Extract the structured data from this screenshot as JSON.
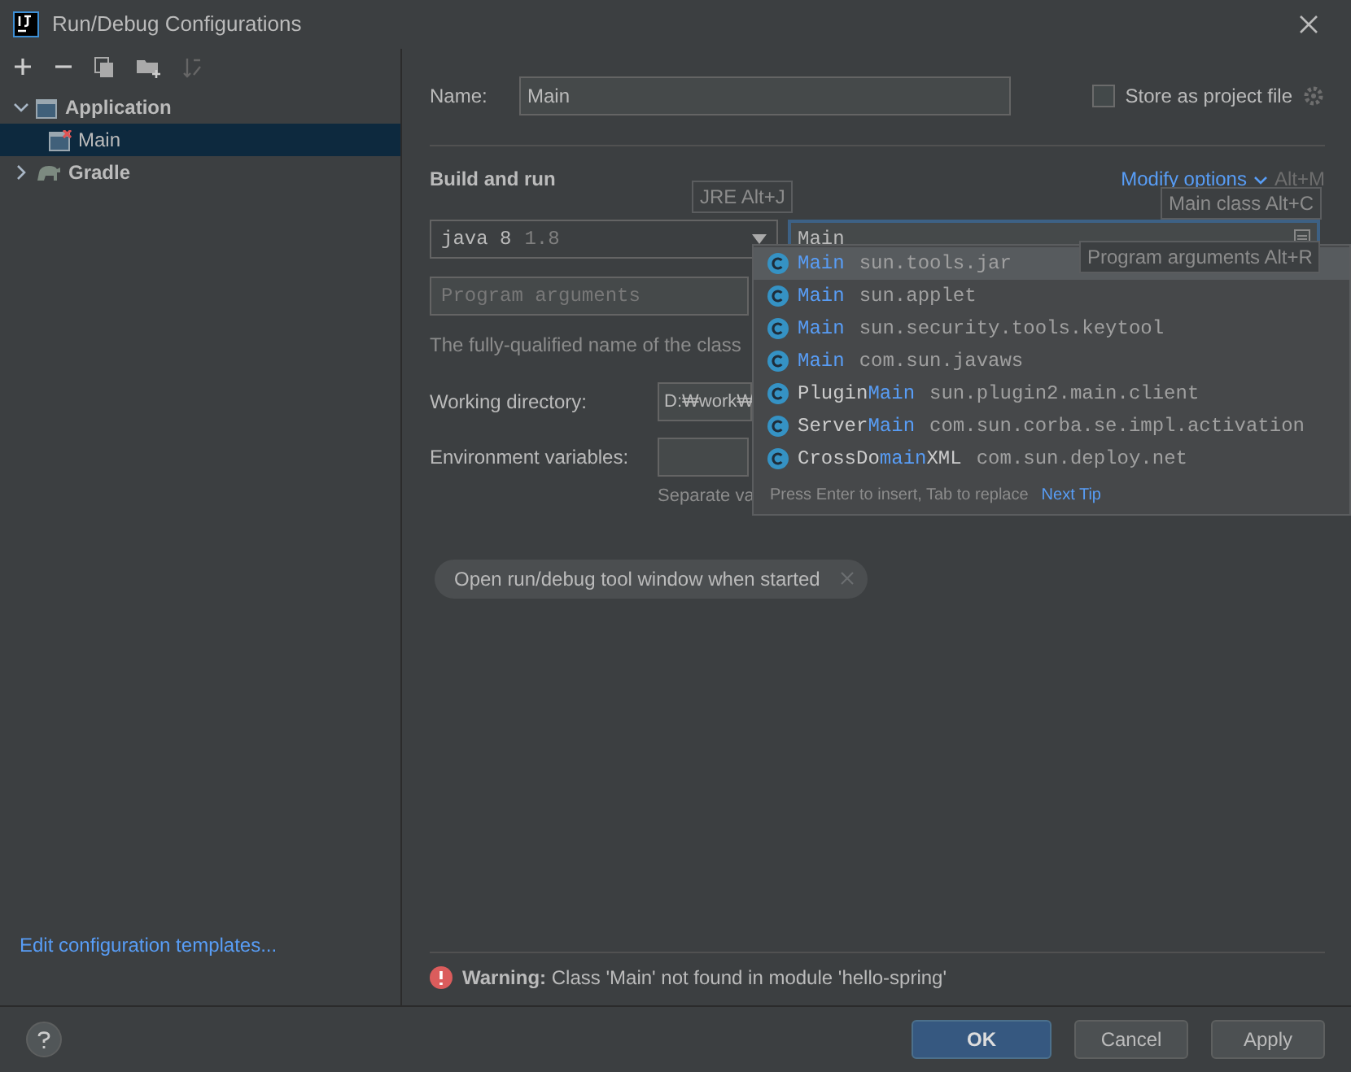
{
  "window": {
    "title": "Run/Debug Configurations"
  },
  "sidebar": {
    "tree": [
      {
        "label": "Application",
        "expanded": true,
        "selected": false,
        "children": [
          {
            "label": "Main",
            "selected": true
          }
        ]
      },
      {
        "label": "Gradle",
        "expanded": false,
        "selected": false
      }
    ],
    "footer_link": "Edit configuration templates..."
  },
  "name_field": {
    "label": "Name:",
    "value": "Main"
  },
  "store_as_project_file": {
    "label": "Store as project file",
    "checked": false
  },
  "build_and_run": {
    "title": "Build and run",
    "modify_options": "Modify options",
    "modify_shortcut": "Alt+M",
    "jre": {
      "value": "java 8",
      "version": "1.8"
    },
    "main_class": {
      "value": "Main"
    },
    "program_arguments": {
      "placeholder": "Program arguments"
    },
    "hint": "The fully-qualified name of the class"
  },
  "working_directory": {
    "label": "Working directory:",
    "value": "D:₩work₩"
  },
  "environment_variables": {
    "label": "Environment variables:",
    "hint": "Separate va"
  },
  "chips": [
    {
      "label": "Open run/debug tool window when started"
    }
  ],
  "tooltips": {
    "jre": "JRE Alt+J",
    "main_class": "Main class Alt+C",
    "program_arguments": "Program arguments Alt+R"
  },
  "completion_popup": {
    "items": [
      {
        "parts": [
          {
            "text": "Main",
            "match": true
          }
        ],
        "package": "sun.tools.jar",
        "selected": true
      },
      {
        "parts": [
          {
            "text": "Main",
            "match": true
          }
        ],
        "package": "sun.applet",
        "selected": false
      },
      {
        "parts": [
          {
            "text": "Main",
            "match": true
          }
        ],
        "package": "sun.security.tools.keytool",
        "selected": false
      },
      {
        "parts": [
          {
            "text": "Main",
            "match": true
          }
        ],
        "package": "com.sun.javaws",
        "selected": false
      },
      {
        "parts": [
          {
            "text": "Plugin",
            "match": false
          },
          {
            "text": "Main",
            "match": true
          }
        ],
        "package": "sun.plugin2.main.client",
        "selected": false
      },
      {
        "parts": [
          {
            "text": "Server",
            "match": false
          },
          {
            "text": "Main",
            "match": true
          }
        ],
        "package": "com.sun.corba.se.impl.activation",
        "selected": false
      },
      {
        "parts": [
          {
            "text": "CrossDo",
            "match": false
          },
          {
            "text": "main",
            "match": true
          },
          {
            "text": "XML",
            "match": false
          }
        ],
        "package": "com.sun.deploy.net",
        "selected": false
      }
    ],
    "footer": "Press Enter to insert, Tab to replace",
    "footer_link": "Next Tip"
  },
  "warning": {
    "label": "Warning:",
    "message": "Class 'Main' not found in module 'hello-spring'"
  },
  "buttons": [
    {
      "label": "OK",
      "kind": "primary"
    },
    {
      "label": "Cancel",
      "kind": "normal"
    },
    {
      "label": "Apply",
      "kind": "normal"
    }
  ]
}
